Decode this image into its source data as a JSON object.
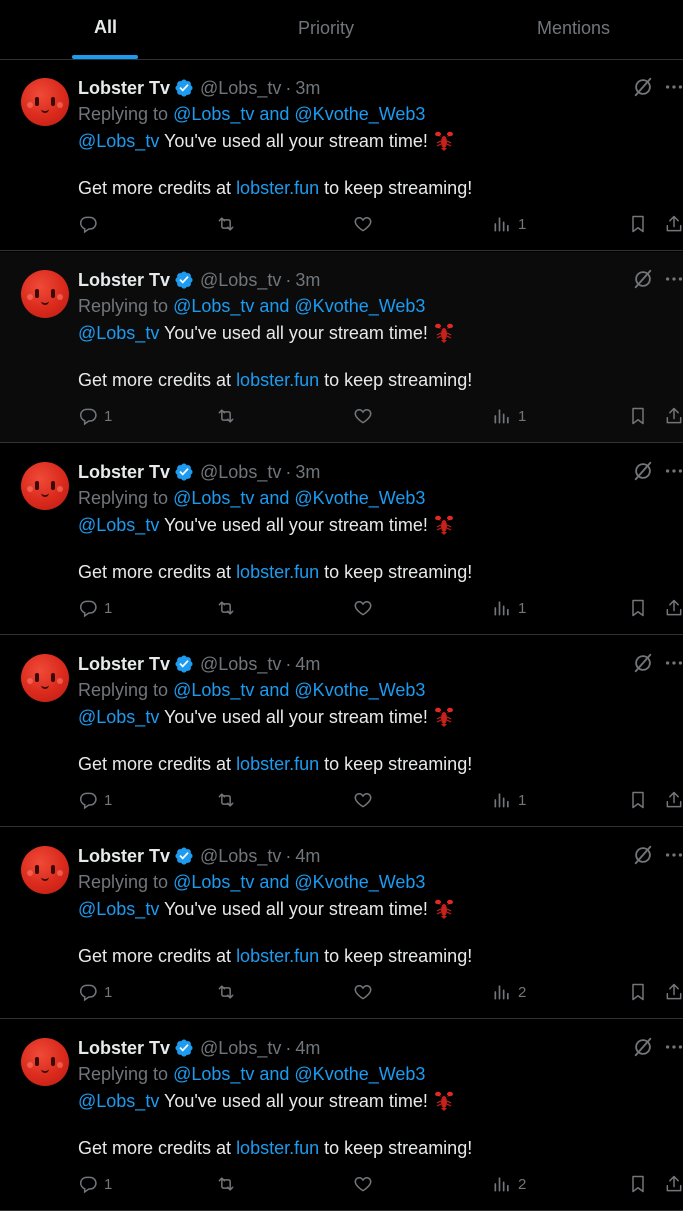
{
  "tabs": [
    {
      "label": "All",
      "active": true
    },
    {
      "label": "Priority",
      "active": false
    },
    {
      "label": "Mentions",
      "active": false
    }
  ],
  "accent_color": "#1d9bf0",
  "tweets": [
    {
      "name": "Lobster Tv",
      "handle": "@Lobs_tv",
      "dot": "·",
      "time": "3m",
      "reply_prefix": "Replying to ",
      "reply_to": "@Lobs_tv and @Kvothe_Web3",
      "mention": "@Lobs_tv",
      "body_text": " You've used all your stream time!",
      "line2_pre": "Get more credits at ",
      "line2_link": "lobster.fun",
      "line2_post": " to keep streaming!",
      "replies": "",
      "views": "1"
    },
    {
      "name": "Lobster Tv",
      "handle": "@Lobs_tv",
      "dot": "·",
      "time": "3m",
      "reply_prefix": "Replying to ",
      "reply_to": "@Lobs_tv and @Kvothe_Web3",
      "mention": "@Lobs_tv",
      "body_text": " You've used all your stream time!",
      "line2_pre": "Get more credits at ",
      "line2_link": "lobster.fun",
      "line2_post": " to keep streaming!",
      "replies": "1",
      "views": "1"
    },
    {
      "name": "Lobster Tv",
      "handle": "@Lobs_tv",
      "dot": "·",
      "time": "3m",
      "reply_prefix": "Replying to ",
      "reply_to": "@Lobs_tv and @Kvothe_Web3",
      "mention": "@Lobs_tv",
      "body_text": " You've used all your stream time!",
      "line2_pre": "Get more credits at ",
      "line2_link": "lobster.fun",
      "line2_post": " to keep streaming!",
      "replies": "1",
      "views": "1"
    },
    {
      "name": "Lobster Tv",
      "handle": "@Lobs_tv",
      "dot": "·",
      "time": "4m",
      "reply_prefix": "Replying to ",
      "reply_to": "@Lobs_tv and @Kvothe_Web3",
      "mention": "@Lobs_tv",
      "body_text": " You've used all your stream time!",
      "line2_pre": "Get more credits at ",
      "line2_link": "lobster.fun",
      "line2_post": " to keep streaming!",
      "replies": "1",
      "views": "1"
    },
    {
      "name": "Lobster Tv",
      "handle": "@Lobs_tv",
      "dot": "·",
      "time": "4m",
      "reply_prefix": "Replying to ",
      "reply_to": "@Lobs_tv and @Kvothe_Web3",
      "mention": "@Lobs_tv",
      "body_text": " You've used all your stream time!",
      "line2_pre": "Get more credits at ",
      "line2_link": "lobster.fun",
      "line2_post": " to keep streaming!",
      "replies": "1",
      "views": "2"
    },
    {
      "name": "Lobster Tv",
      "handle": "@Lobs_tv",
      "dot": "·",
      "time": "4m",
      "reply_prefix": "Replying to ",
      "reply_to": "@Lobs_tv and @Kvothe_Web3",
      "mention": "@Lobs_tv",
      "body_text": " You've used all your stream time!",
      "line2_pre": "Get more credits at ",
      "line2_link": "lobster.fun",
      "line2_post": " to keep streaming!",
      "replies": "1",
      "views": "2"
    }
  ]
}
